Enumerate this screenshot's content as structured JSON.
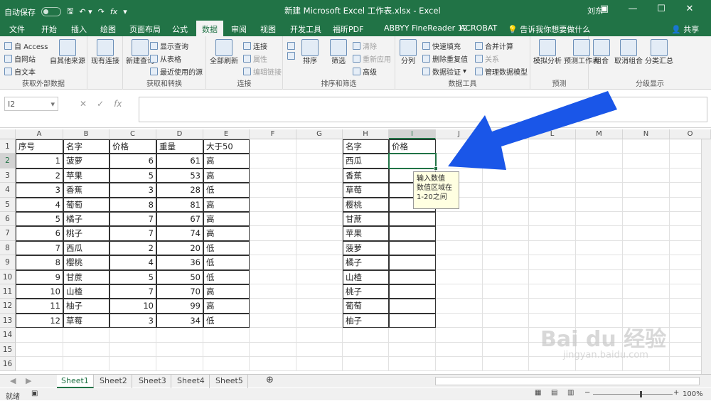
{
  "titlebar": {
    "autosave": "自动保存",
    "autosave_state": "关",
    "title": "新建 Microsoft Excel 工作表.xlsx  -  Excel",
    "user": "刘东"
  },
  "tabs": [
    "文件",
    "开始",
    "插入",
    "绘图",
    "页面布局",
    "公式",
    "数据",
    "审阅",
    "视图",
    "开发工具",
    "福昕PDF",
    "ABBYY FineReader 12",
    "ACROBAT"
  ],
  "tell_me": "告诉我你想要做什么",
  "share": "共享",
  "ribbon": {
    "g1": {
      "label": "获取外部数据",
      "items": [
        "自 Access",
        "自网站",
        "自文本"
      ],
      "big1": "自其他来源",
      "big2": "现有连接"
    },
    "g2": {
      "label": "获取和转换",
      "big": "新建查询",
      "items": [
        "显示查询",
        "从表格",
        "最近使用的源"
      ]
    },
    "g3": {
      "label": "连接",
      "big": "全部刷新",
      "items": [
        "连接",
        "属性",
        "编辑链接"
      ]
    },
    "g4": {
      "label": "排序和筛选",
      "sort": "排序",
      "filter": "筛选",
      "items": [
        "清除",
        "重新应用",
        "高级"
      ]
    },
    "g5": {
      "label": "数据工具",
      "split": "分列",
      "items": [
        "快速填充",
        "删除重复值",
        "数据验证",
        "合并计算",
        "关系",
        "管理数据模型"
      ]
    },
    "g6": {
      "label": "预测",
      "big1": "模拟分析",
      "big2": "预测工作表"
    },
    "g7": {
      "label": "分级显示",
      "big1": "组合",
      "big2": "取消组合",
      "big3": "分类汇总"
    }
  },
  "namebox": "I2",
  "columns": [
    "A",
    "B",
    "C",
    "D",
    "E",
    "F",
    "G",
    "H",
    "I",
    "J",
    "K",
    "L",
    "M",
    "N",
    "O"
  ],
  "rows": [
    "1",
    "2",
    "3",
    "4",
    "5",
    "6",
    "7",
    "8",
    "9",
    "10",
    "11",
    "12",
    "13",
    "14",
    "15",
    "16"
  ],
  "table1": {
    "headers": [
      "序号",
      "名字",
      "价格",
      "重量",
      "大于50"
    ],
    "rows": [
      [
        "1",
        "菠萝",
        "6",
        "61",
        "高"
      ],
      [
        "2",
        "苹果",
        "5",
        "53",
        "高"
      ],
      [
        "3",
        "香蕉",
        "3",
        "28",
        "低"
      ],
      [
        "4",
        "葡萄",
        "8",
        "81",
        "高"
      ],
      [
        "5",
        "橘子",
        "7",
        "67",
        "高"
      ],
      [
        "6",
        "桃子",
        "7",
        "74",
        "高"
      ],
      [
        "7",
        "西瓜",
        "2",
        "20",
        "低"
      ],
      [
        "8",
        "樱桃",
        "4",
        "36",
        "低"
      ],
      [
        "9",
        "甘蔗",
        "5",
        "50",
        "低"
      ],
      [
        "10",
        "山楂",
        "7",
        "70",
        "高"
      ],
      [
        "11",
        "柚子",
        "10",
        "99",
        "高"
      ],
      [
        "12",
        "草莓",
        "3",
        "34",
        "低"
      ]
    ]
  },
  "table2": {
    "headers": [
      "名字",
      "价格"
    ],
    "names": [
      "西瓜",
      "香蕉",
      "草莓",
      "樱桃",
      "甘蔗",
      "苹果",
      "菠萝",
      "橘子",
      "山楂",
      "桃子",
      "葡萄",
      "柚子"
    ]
  },
  "tooltip": {
    "title": "输入数值",
    "body": "数值区域在1-20之间"
  },
  "sheets": [
    "Sheet1",
    "Sheet2",
    "Sheet3",
    "Sheet4",
    "Sheet5"
  ],
  "status": {
    "mode": "就绪",
    "zoom": "100%"
  },
  "watermark": {
    "brand": "Bai du 经验",
    "url": "jingyan.baidu.com"
  },
  "colors": {
    "excel_green": "#217346",
    "arrow_blue": "#1a56e8"
  }
}
